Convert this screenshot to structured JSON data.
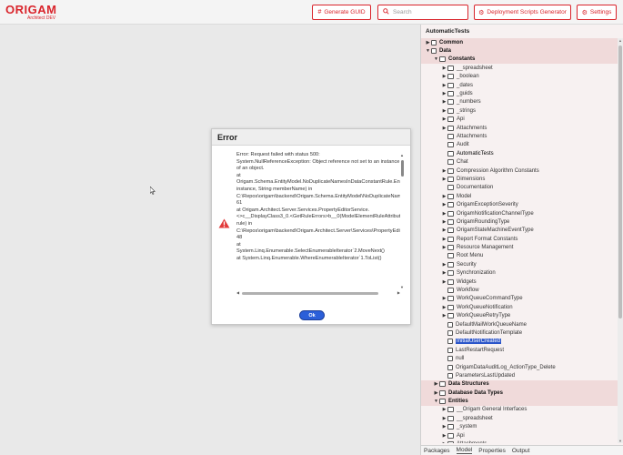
{
  "app": {
    "logo_main": "ORIGAM",
    "logo_sub": "Architect DEV"
  },
  "toolbar": {
    "generate_guid": "Generate GUID",
    "search_placeholder": "Search",
    "deployment": "Deployment Scripts Generator",
    "settings": "Settings"
  },
  "panel": {
    "title": "AutomaticTests",
    "tree": [
      {
        "label": "Common",
        "depth": 0,
        "toggle": "▶",
        "icon": "item",
        "bold": true,
        "hl": true
      },
      {
        "label": "Data",
        "depth": 0,
        "toggle": "▼",
        "icon": "item",
        "bold": true,
        "hl": true
      },
      {
        "label": "Constants",
        "depth": 1,
        "toggle": "▼",
        "icon": "folder",
        "bold": true,
        "hl": true
      },
      {
        "label": "__spreadsheet",
        "depth": 2,
        "toggle": "▶",
        "icon": "folder"
      },
      {
        "label": "_boolean",
        "depth": 2,
        "toggle": "▶",
        "icon": "folder"
      },
      {
        "label": "_dates",
        "depth": 2,
        "toggle": "▶",
        "icon": "folder"
      },
      {
        "label": "_guids",
        "depth": 2,
        "toggle": "▶",
        "icon": "folder"
      },
      {
        "label": "_numbers",
        "depth": 2,
        "toggle": "▶",
        "icon": "folder"
      },
      {
        "label": "_strings",
        "depth": 2,
        "toggle": "▶",
        "icon": "folder"
      },
      {
        "label": "Api",
        "depth": 2,
        "toggle": "▶",
        "icon": "folder"
      },
      {
        "label": "Attachments",
        "depth": 2,
        "toggle": "▶",
        "icon": "folder"
      },
      {
        "label": "Attachments",
        "depth": 2,
        "toggle": "",
        "icon": "folder"
      },
      {
        "label": "Audit",
        "depth": 2,
        "toggle": "",
        "icon": "folder"
      },
      {
        "label": "AutomaticTests",
        "depth": 2,
        "toggle": "",
        "icon": "folder",
        "dark": true
      },
      {
        "label": "Chat",
        "depth": 2,
        "toggle": "",
        "icon": "folder"
      },
      {
        "label": "Compression Algorithm Constants",
        "depth": 2,
        "toggle": "▶",
        "icon": "folder"
      },
      {
        "label": "Dimensions",
        "depth": 2,
        "toggle": "▶",
        "icon": "folder"
      },
      {
        "label": "Documentation",
        "depth": 2,
        "toggle": "",
        "icon": "folder"
      },
      {
        "label": "Model",
        "depth": 2,
        "toggle": "▶",
        "icon": "folder"
      },
      {
        "label": "OrigamExceptionSeverity",
        "depth": 2,
        "toggle": "▶",
        "icon": "folder"
      },
      {
        "label": "OrigamNotificationChannelType",
        "depth": 2,
        "toggle": "▶",
        "icon": "folder"
      },
      {
        "label": "OrigamRoundingType",
        "depth": 2,
        "toggle": "▶",
        "icon": "folder"
      },
      {
        "label": "OrigamStateMachineEventType",
        "depth": 2,
        "toggle": "▶",
        "icon": "folder"
      },
      {
        "label": "Report Format Constants",
        "depth": 2,
        "toggle": "▶",
        "icon": "folder"
      },
      {
        "label": "Resource Management",
        "depth": 2,
        "toggle": "▶",
        "icon": "folder"
      },
      {
        "label": "Root Menu",
        "depth": 2,
        "toggle": "",
        "icon": "folder"
      },
      {
        "label": "Security",
        "depth": 2,
        "toggle": "▶",
        "icon": "folder"
      },
      {
        "label": "Synchronization",
        "depth": 2,
        "toggle": "▶",
        "icon": "folder"
      },
      {
        "label": "Widgets",
        "depth": 2,
        "toggle": "▶",
        "icon": "folder"
      },
      {
        "label": "Workflow",
        "depth": 2,
        "toggle": "",
        "icon": "folder"
      },
      {
        "label": "WorkQueueCommandType",
        "depth": 2,
        "toggle": "▶",
        "icon": "folder"
      },
      {
        "label": "WorkQueueNotification",
        "depth": 2,
        "toggle": "▶",
        "icon": "folder"
      },
      {
        "label": "WorkQueueRetryType",
        "depth": 2,
        "toggle": "▶",
        "icon": "folder"
      },
      {
        "label": "DefaultMailWorkQueueName",
        "depth": 2,
        "toggle": "",
        "icon": "item"
      },
      {
        "label": "DefaultNotificationTemplate",
        "depth": 2,
        "toggle": "",
        "icon": "item"
      },
      {
        "label": "InitialUserCreated",
        "depth": 2,
        "toggle": "",
        "icon": "item",
        "sel": true
      },
      {
        "label": "LastRestartRequest",
        "depth": 2,
        "toggle": "",
        "icon": "item"
      },
      {
        "label": "null",
        "depth": 2,
        "toggle": "",
        "icon": "item"
      },
      {
        "label": "OrigamDataAuditLog_ActionType_Delete",
        "depth": 2,
        "toggle": "",
        "icon": "item"
      },
      {
        "label": "ParametersLastUpdated",
        "depth": 2,
        "toggle": "",
        "icon": "item"
      },
      {
        "label": "Data Structures",
        "depth": 1,
        "toggle": "▶",
        "icon": "folder",
        "bold": true,
        "hl": true
      },
      {
        "label": "Database Data Types",
        "depth": 1,
        "toggle": "▶",
        "icon": "folder",
        "bold": true,
        "hl": true
      },
      {
        "label": "Entities",
        "depth": 1,
        "toggle": "▼",
        "icon": "folder",
        "bold": true,
        "hl": true
      },
      {
        "label": "__Origam General Interfaces",
        "depth": 2,
        "toggle": "▶",
        "icon": "folder"
      },
      {
        "label": "__spreadsheet",
        "depth": 2,
        "toggle": "▶",
        "icon": "folder"
      },
      {
        "label": "_system",
        "depth": 2,
        "toggle": "▶",
        "icon": "folder"
      },
      {
        "label": "Api",
        "depth": 2,
        "toggle": "▶",
        "icon": "folder"
      },
      {
        "label": "Attachments",
        "depth": 2,
        "toggle": "▶",
        "icon": "folder"
      }
    ],
    "tabs": [
      "Packages",
      "Model",
      "Properties",
      "Output"
    ]
  },
  "dialog": {
    "title": "Error",
    "lines": [
      "Error: Request failed with status 500:",
      "System.NullReferenceException: Object reference not set to an instance of an object.",
      "   at",
      "Origam.Schema.EntityModel.NoDuplicateNamesInDataConstantRule.EntityModel.NoDuplicateNamesInDataConstantRule.GetErrors(Object",
      "instance, String memberName) in",
      "C:\\Repos\\origam\\backend\\Origam.Schema.EntityModel\\NoDuplicateNamesInDataConstantRule.cs:line",
      "61",
      "   at Origam.Architect.Server.Services.PropertyEditorService.",
      "<>c__DisplayClass3_0.<GetRuleErrors>b__0(ModelElementRuleAttribute",
      "rule) in",
      "C:\\Repos\\origam\\backend\\Origam.Architect.Server\\Services\\PropertyEditorService.cs:line",
      "48",
      "   at",
      "System.Linq.Enumerable.SelectEnumerableIterator`2.MoveNext()",
      "   at System.Linq.Enumerable.WhereEnumerableIterator`1.ToList()"
    ],
    "ok_label": "Ok"
  },
  "colors": {
    "brand": "#d9242b",
    "selection": "#2b55c9",
    "panel_highlight": "#f0dada"
  },
  "icons": [
    "grid-icon",
    "search-icon",
    "gear-icon",
    "warning-icon",
    "folder-icon",
    "document-icon",
    "cursor-icon"
  ]
}
